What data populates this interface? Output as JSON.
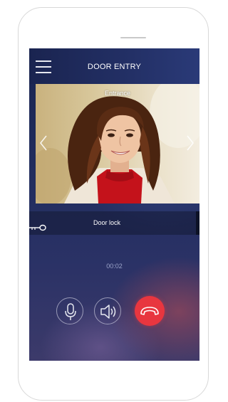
{
  "header": {
    "title": "DOOR ENTRY"
  },
  "video": {
    "label": "Entrance"
  },
  "door_lock": {
    "label": "Door lock"
  },
  "call": {
    "duration": "00:02"
  },
  "icons": {
    "menu": "menu-icon",
    "prev": "chevron-left-icon",
    "next": "chevron-right-icon",
    "key": "key-icon",
    "microphone": "microphone-icon",
    "speaker": "speaker-icon",
    "hangup": "phone-hangup-icon"
  },
  "colors": {
    "hangup_button": "#e8363f",
    "header_background": "#1a2450"
  }
}
